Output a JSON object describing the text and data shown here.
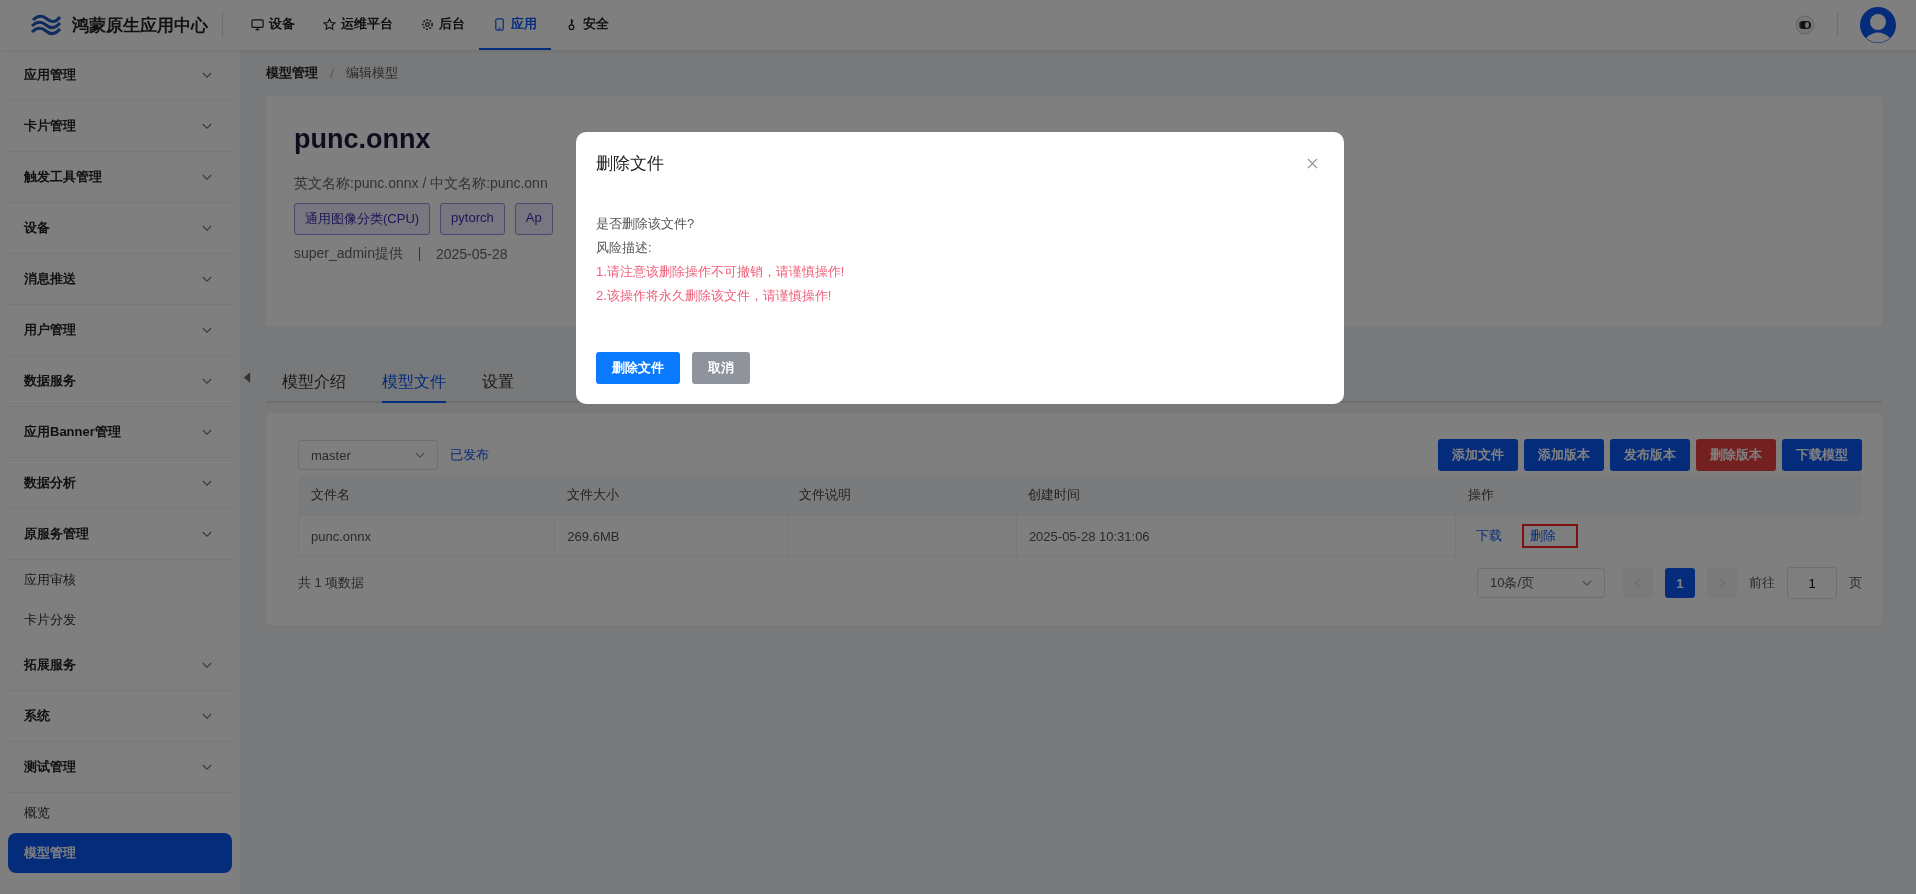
{
  "app": {
    "title": "鸿蒙原生应用中心"
  },
  "nav": [
    {
      "label": "设备",
      "selected": false
    },
    {
      "label": "运维平台",
      "selected": false
    },
    {
      "label": "后台",
      "selected": false
    },
    {
      "label": "应用",
      "selected": true
    },
    {
      "label": "安全",
      "selected": false
    }
  ],
  "sidebar": {
    "items": [
      {
        "label": "应用管理"
      },
      {
        "label": "卡片管理"
      },
      {
        "label": "触发工具管理"
      },
      {
        "label": "设备"
      },
      {
        "label": "消息推送"
      },
      {
        "label": "用户管理"
      },
      {
        "label": "数据服务"
      },
      {
        "label": "应用Banner管理"
      },
      {
        "label": "数据分析"
      },
      {
        "label": "原服务管理",
        "children": [
          {
            "label": "应用审核",
            "selected": false
          },
          {
            "label": "卡片分发",
            "selected": false
          }
        ]
      },
      {
        "label": "拓展服务"
      },
      {
        "label": "系统"
      },
      {
        "label": "测试管理",
        "children": [
          {
            "label": "概览",
            "selected": false
          },
          {
            "label": "模型管理",
            "selected": true
          }
        ]
      }
    ]
  },
  "breadcrumb": {
    "separator": "/",
    "items": [
      "模型管理",
      "编辑模型"
    ]
  },
  "model": {
    "name": "punc.onnx",
    "names": "英文名称:punc.onnx / 中文名称:punc.onn",
    "tags": [
      "通用图像分类(CPU)",
      "pytorch",
      "Ap"
    ],
    "provider": "super_admin提供",
    "date": "2025-05-28"
  },
  "tabs": [
    {
      "label": "模型介绍",
      "selected": false
    },
    {
      "label": "模型文件",
      "selected": true
    },
    {
      "label": "设置",
      "selected": false
    }
  ],
  "branch": {
    "value": "master",
    "status": "已发布"
  },
  "actions": [
    {
      "label": "添加文件",
      "kind": "primary"
    },
    {
      "label": "添加版本",
      "kind": "primary"
    },
    {
      "label": "发布版本",
      "kind": "primary"
    },
    {
      "label": "删除版本",
      "kind": "danger"
    },
    {
      "label": "下载模型",
      "kind": "primary"
    }
  ],
  "table": {
    "columns": [
      "文件名",
      "文件大小",
      "文件说明",
      "创建时间",
      "操作"
    ],
    "rows": [
      {
        "name": "punc.onnx",
        "size": "269.6MB",
        "description": "",
        "created": "2025-05-28 10:31:06",
        "links": [
          {
            "label": "下载",
            "highlighted": false
          },
          {
            "label": "删除",
            "highlighted": true
          }
        ]
      }
    ]
  },
  "pagination": {
    "total": "共 1 项数据",
    "page_size": "10条/页",
    "pages": [
      {
        "label": "1",
        "selected": true
      }
    ],
    "goto_label": "前往",
    "goto_value": "1",
    "goto_suffix": "页"
  },
  "dialog": {
    "title": "删除文件",
    "lines": [
      {
        "text": "是否删除该文件?",
        "kind": "normal"
      },
      {
        "text": "风险描述:",
        "kind": "normal"
      },
      {
        "text": "1.请注意该删除操作不可撤销，请谨慎操作!",
        "kind": "warning"
      },
      {
        "text": "2.该操作将永久删除该文件，请谨慎操作!",
        "kind": "warning"
      }
    ],
    "buttons": [
      {
        "label": "删除文件",
        "kind": "primary"
      },
      {
        "label": "取消",
        "kind": "secondary"
      }
    ]
  }
}
